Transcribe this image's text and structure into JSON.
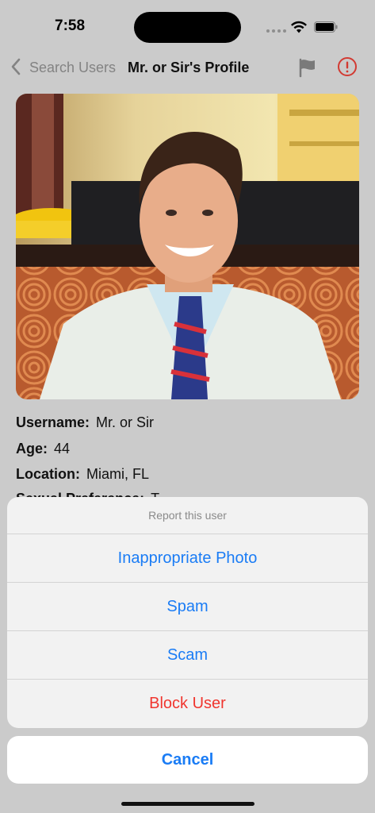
{
  "status": {
    "time": "7:58"
  },
  "nav": {
    "back_label": "Search Users",
    "title": "Mr. or Sir's Profile"
  },
  "profile": {
    "username_label": "Username:",
    "username": "Mr. or Sir",
    "age_label": "Age:",
    "age": "44",
    "location_label": "Location:",
    "location": "Miami, FL",
    "partial_label": "Sexual Preference:",
    "partial_value": "T"
  },
  "sheet": {
    "title": "Report this user",
    "actions": [
      "Inappropriate Photo",
      "Spam",
      "Scam",
      "Block User"
    ],
    "cancel": "Cancel"
  },
  "colors": {
    "accent": "#1a7cf5",
    "destructive": "#f0362f"
  },
  "icons": [
    "back-chevron-icon",
    "flag-icon",
    "alert-circle-icon",
    "wifi-icon",
    "battery-icon"
  ]
}
